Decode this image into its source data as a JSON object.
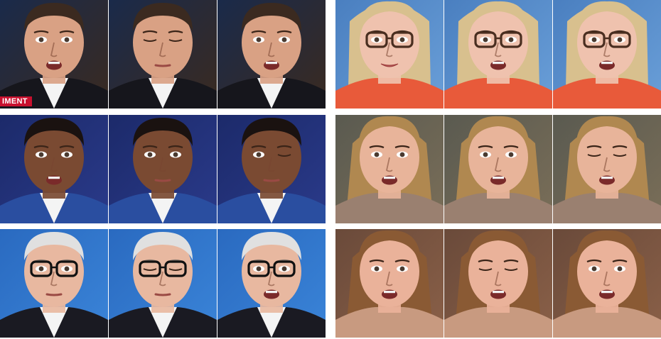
{
  "figure": {
    "groups": [
      {
        "id": "left-top",
        "chyron": "IMENT"
      },
      {
        "id": "right-top"
      },
      {
        "id": "left-mid"
      },
      {
        "id": "right-mid"
      },
      {
        "id": "left-bottom"
      },
      {
        "id": "right-bottom"
      }
    ]
  }
}
